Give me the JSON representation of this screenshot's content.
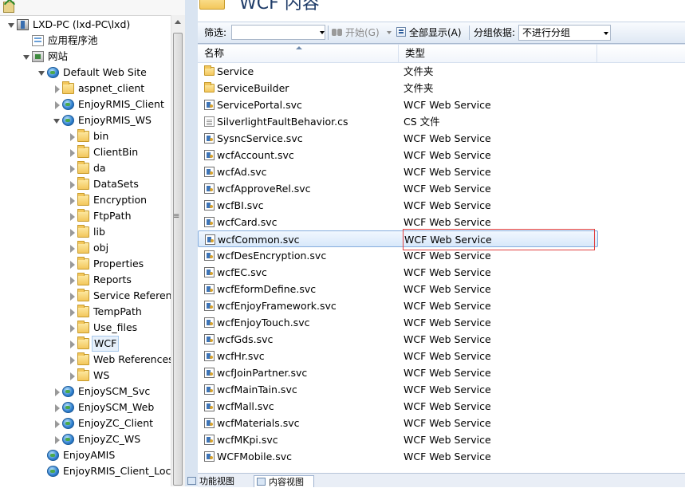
{
  "tree": {
    "nodes": [
      {
        "label": "LXD-PC (lxd-PC\\lxd)",
        "icon": "server-icon",
        "exp": "open"
      },
      {
        "label": "应用程序池",
        "icon": "app-pool-icon",
        "exp": "none"
      },
      {
        "label": "网站",
        "icon": "sites-icon",
        "exp": "open"
      },
      {
        "label": "Default Web Site",
        "icon": "globe-icon",
        "exp": "open"
      },
      {
        "label": "aspnet_client",
        "icon": "folder-icon",
        "exp": "closed"
      },
      {
        "label": "EnjoyRMIS_Client",
        "icon": "globe-icon",
        "exp": "closed"
      },
      {
        "label": "EnjoyRMIS_WS",
        "icon": "globe-icon",
        "exp": "open"
      },
      {
        "label": "bin",
        "icon": "folder-icon",
        "exp": "closed"
      },
      {
        "label": "ClientBin",
        "icon": "folder-icon",
        "exp": "closed"
      },
      {
        "label": "da",
        "icon": "folder-icon",
        "exp": "closed"
      },
      {
        "label": "DataSets",
        "icon": "folder-icon",
        "exp": "closed"
      },
      {
        "label": "Encryption",
        "icon": "folder-icon",
        "exp": "closed"
      },
      {
        "label": "FtpPath",
        "icon": "folder-icon",
        "exp": "closed"
      },
      {
        "label": "lib",
        "icon": "folder-icon",
        "exp": "closed"
      },
      {
        "label": "obj",
        "icon": "folder-icon",
        "exp": "closed"
      },
      {
        "label": "Properties",
        "icon": "folder-icon",
        "exp": "closed"
      },
      {
        "label": "Reports",
        "icon": "folder-icon",
        "exp": "closed"
      },
      {
        "label": "Service Referen",
        "icon": "folder-icon",
        "exp": "closed"
      },
      {
        "label": "TempPath",
        "icon": "folder-icon",
        "exp": "closed"
      },
      {
        "label": "Use_files",
        "icon": "folder-icon",
        "exp": "closed"
      },
      {
        "label": "WCF",
        "icon": "folder-icon",
        "exp": "closed",
        "selected": true
      },
      {
        "label": "Web References",
        "icon": "folder-icon",
        "exp": "closed"
      },
      {
        "label": "WS",
        "icon": "folder-icon",
        "exp": "closed"
      },
      {
        "label": "EnjoySCM_Svc",
        "icon": "globe-icon",
        "exp": "closed"
      },
      {
        "label": "EnjoySCM_Web",
        "icon": "globe-icon",
        "exp": "closed"
      },
      {
        "label": "EnjoyZC_Client",
        "icon": "globe-icon",
        "exp": "closed"
      },
      {
        "label": "EnjoyZC_WS",
        "icon": "globe-icon",
        "exp": "closed"
      },
      {
        "label": "EnjoyAMIS",
        "icon": "globe-icon",
        "exp": "none"
      },
      {
        "label": "EnjoyRMIS_Client_Loca",
        "icon": "globe-icon",
        "exp": "none"
      }
    ]
  },
  "header": {
    "title": "WCF 内容"
  },
  "filterbar": {
    "filter_label": "筛选:",
    "start_label": "开始(G)",
    "show_all_label": "全部显示(A)",
    "group_by_label": "分组依据:",
    "group_by_value": "不进行分组"
  },
  "grid": {
    "col_name": "名称",
    "col_type": "类型",
    "rows": [
      {
        "name": "Service",
        "type": "文件夹",
        "icon": "folder-icon"
      },
      {
        "name": "ServiceBuilder",
        "type": "文件夹",
        "icon": "folder-icon"
      },
      {
        "name": "ServicePortal.svc",
        "type": "WCF Web Service",
        "icon": "svc-file-icon"
      },
      {
        "name": "SilverlightFaultBehavior.cs",
        "type": "CS 文件",
        "icon": "cs-file-icon"
      },
      {
        "name": "SysncService.svc",
        "type": "WCF Web Service",
        "icon": "svc-file-icon"
      },
      {
        "name": "wcfAccount.svc",
        "type": "WCF Web Service",
        "icon": "svc-file-icon"
      },
      {
        "name": "wcfAd.svc",
        "type": "WCF Web Service",
        "icon": "svc-file-icon"
      },
      {
        "name": "wcfApproveRel.svc",
        "type": "WCF Web Service",
        "icon": "svc-file-icon"
      },
      {
        "name": "wcfBI.svc",
        "type": "WCF Web Service",
        "icon": "svc-file-icon"
      },
      {
        "name": "wcfCard.svc",
        "type": "WCF Web Service",
        "icon": "svc-file-icon"
      },
      {
        "name": "wcfCommon.svc",
        "type": "WCF Web Service",
        "icon": "svc-file-icon",
        "selected": true
      },
      {
        "name": "wcfDesEncryption.svc",
        "type": "WCF Web Service",
        "icon": "svc-file-icon"
      },
      {
        "name": "wcfEC.svc",
        "type": "WCF Web Service",
        "icon": "svc-file-icon"
      },
      {
        "name": "wcfEformDefine.svc",
        "type": "WCF Web Service",
        "icon": "svc-file-icon"
      },
      {
        "name": "wcfEnjoyFramework.svc",
        "type": "WCF Web Service",
        "icon": "svc-file-icon"
      },
      {
        "name": "wcfEnjoyTouch.svc",
        "type": "WCF Web Service",
        "icon": "svc-file-icon"
      },
      {
        "name": "wcfGds.svc",
        "type": "WCF Web Service",
        "icon": "svc-file-icon"
      },
      {
        "name": "wcfHr.svc",
        "type": "WCF Web Service",
        "icon": "svc-file-icon"
      },
      {
        "name": "wcfJoinPartner.svc",
        "type": "WCF Web Service",
        "icon": "svc-file-icon"
      },
      {
        "name": "wcfMainTain.svc",
        "type": "WCF Web Service",
        "icon": "svc-file-icon"
      },
      {
        "name": "wcfMall.svc",
        "type": "WCF Web Service",
        "icon": "svc-file-icon"
      },
      {
        "name": "wcfMaterials.svc",
        "type": "WCF Web Service",
        "icon": "svc-file-icon"
      },
      {
        "name": "wcfMKpi.svc",
        "type": "WCF Web Service",
        "icon": "svc-file-icon"
      },
      {
        "name": "WCFMobile.svc",
        "type": "WCF Web Service",
        "icon": "svc-file-icon"
      }
    ]
  },
  "bottom_tabs": [
    {
      "label": "功能视图"
    },
    {
      "label": "内容视图",
      "active": true
    }
  ],
  "colors": {
    "selection_border": "#84acdd",
    "annotation_box": "#e04040",
    "title": "#1e3b68"
  }
}
